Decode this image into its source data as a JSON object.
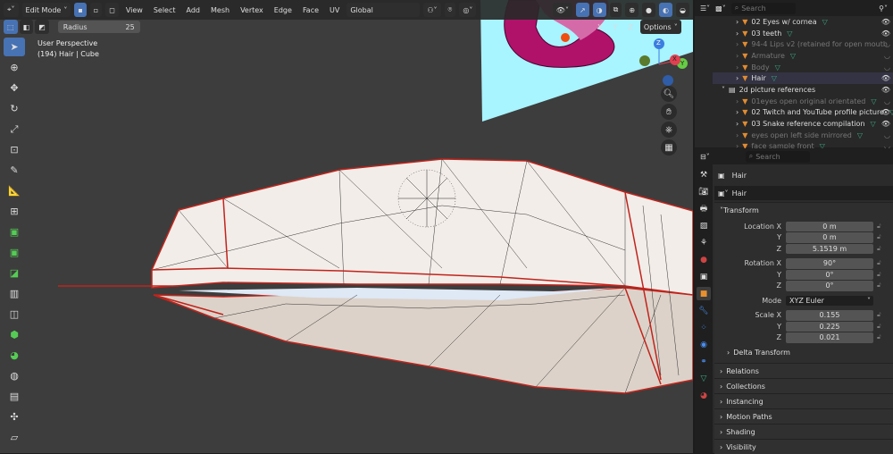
{
  "header": {
    "mode": "Edit Mode",
    "menus": [
      "View",
      "Select",
      "Add",
      "Mesh",
      "Vertex",
      "Edge",
      "Face",
      "UV"
    ],
    "orientation": "Global",
    "options": "Options",
    "axes": [
      "X",
      "Y",
      "Z"
    ]
  },
  "tool_settings": {
    "radius_label": "Radius",
    "radius_value": "25"
  },
  "viewport": {
    "perspective": "User Perspective",
    "object_info": "(194) Hair | Cube"
  },
  "gizmo": {
    "z": "Z",
    "x": "X",
    "y": "Y"
  },
  "outliner": {
    "search_placeholder": "Search",
    "items": [
      {
        "label": "02 Eyes w/ cornea",
        "dim": false
      },
      {
        "label": "03 teeth",
        "dim": false
      },
      {
        "label": "94-4 Lips v2 (retained for open mouth",
        "dim": true
      },
      {
        "label": "Armature",
        "dim": true
      },
      {
        "label": "Body",
        "dim": true
      },
      {
        "label": "Hair",
        "dim": false
      },
      {
        "label": "2d picture references",
        "dim": false
      },
      {
        "label": "01eyes open original orientated",
        "dim": true
      },
      {
        "label": "02 Twitch and YouTube profile picture",
        "dim": false
      },
      {
        "label": "03 Snake reference compilation",
        "dim": false
      },
      {
        "label": "eyes open left side mirrored",
        "dim": true
      },
      {
        "label": "face sample front",
        "dim": true
      }
    ]
  },
  "properties": {
    "search_placeholder": "Search",
    "object_name": "Hair",
    "name_field": "Hair",
    "transform_label": "Transform",
    "location": {
      "label": "Location X",
      "x": "0 m",
      "y": "0 m",
      "z": "5.1519 m"
    },
    "rotation": {
      "label": "Rotation X",
      "x": "90°",
      "y": "0°",
      "z": "0°"
    },
    "mode": {
      "label": "Mode",
      "value": "XYZ Euler"
    },
    "scale": {
      "label": "Scale X",
      "x": "0.155",
      "y": "0.225",
      "z": "0.021"
    },
    "y_label": "Y",
    "z_label": "Z",
    "delta": "Delta Transform",
    "panels": [
      "Relations",
      "Collections",
      "Instancing",
      "Motion Paths",
      "Shading",
      "Visibility"
    ]
  },
  "colors": {
    "accent": "#4772b3",
    "edge_selected": "#c0241c",
    "reference_bg": "#a8f4ff",
    "snake": "#b0126a"
  }
}
